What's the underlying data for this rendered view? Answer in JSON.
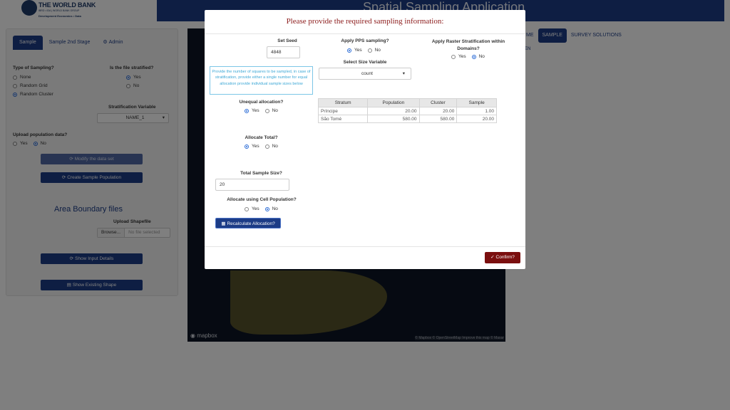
{
  "header": {
    "logo_title": "THE WORLD BANK",
    "logo_sub": "IBRD • IDA | WORLD BANK GROUP",
    "logo_unit": "Development Economics • Data",
    "app_title": "Spatial Sampling Application"
  },
  "tabs": [
    "Sample",
    "Sample 2nd Stage",
    "Admin"
  ],
  "sidebar": {
    "type_label": "Type of Sampling?",
    "type_options": [
      "None",
      "Random Grid",
      "Random Cluster"
    ],
    "stratified_label": "Is the file stratified?",
    "stratified_options": [
      "Yes",
      "No"
    ],
    "strat_var_label": "Stratification Variable",
    "strat_var_value": "NAME_1",
    "upload_pop_label": "Upload population data?",
    "upload_pop_options": [
      "Yes",
      "No"
    ],
    "modify_btn": "Modify the data set",
    "create_btn": "Create Sample Population",
    "area_title": "Area Boundary files",
    "upload_shape_label": "Upload Shapefile",
    "browse": "Browse...",
    "no_file": "No file selected",
    "show_input_btn": "Show Input Details",
    "show_shape_btn": "Show Existing Shape"
  },
  "nav_right": [
    "ME",
    "SAMPLE",
    "SURVEY SOLUTIONS"
  ],
  "nav_sub": "EN",
  "map": {
    "brand": "mapbox",
    "attribution": "© Mapbox © OpenStreetMap Improve this map © Maxar"
  },
  "modal": {
    "title": "Please provide the required sampling information:",
    "seed_label": "Set Seed",
    "seed_value": "4848",
    "info_text": "Provide the number of squares to be sampled, in case of stratification, provide either a single number for equal allocation provide individual sample sizes below",
    "pps_label": "Apply PPS sampling?",
    "size_var_label": "Select Size Variable",
    "size_var_value": "count",
    "raster_label": "Apply Raster Stratification within Domains?",
    "unequal_label": "Unequal allocation?",
    "alloc_total_label": "Allocate Total?",
    "total_label": "Total Sample Size?",
    "total_value": "20",
    "cell_pop_label": "Allocate using Cell Population?",
    "yes": "Yes",
    "no": "No",
    "recalc_btn": "Recalculate Allocation?",
    "confirm_btn": "Confirm?",
    "table": {
      "headers": [
        "Stratum",
        "Population",
        "Cluster",
        "Sample"
      ],
      "rows": [
        [
          "Príncipe",
          "20.00",
          "20.00",
          "1.00"
        ],
        [
          "São Tomé",
          "580.00",
          "580.00",
          "20.00"
        ]
      ]
    }
  }
}
